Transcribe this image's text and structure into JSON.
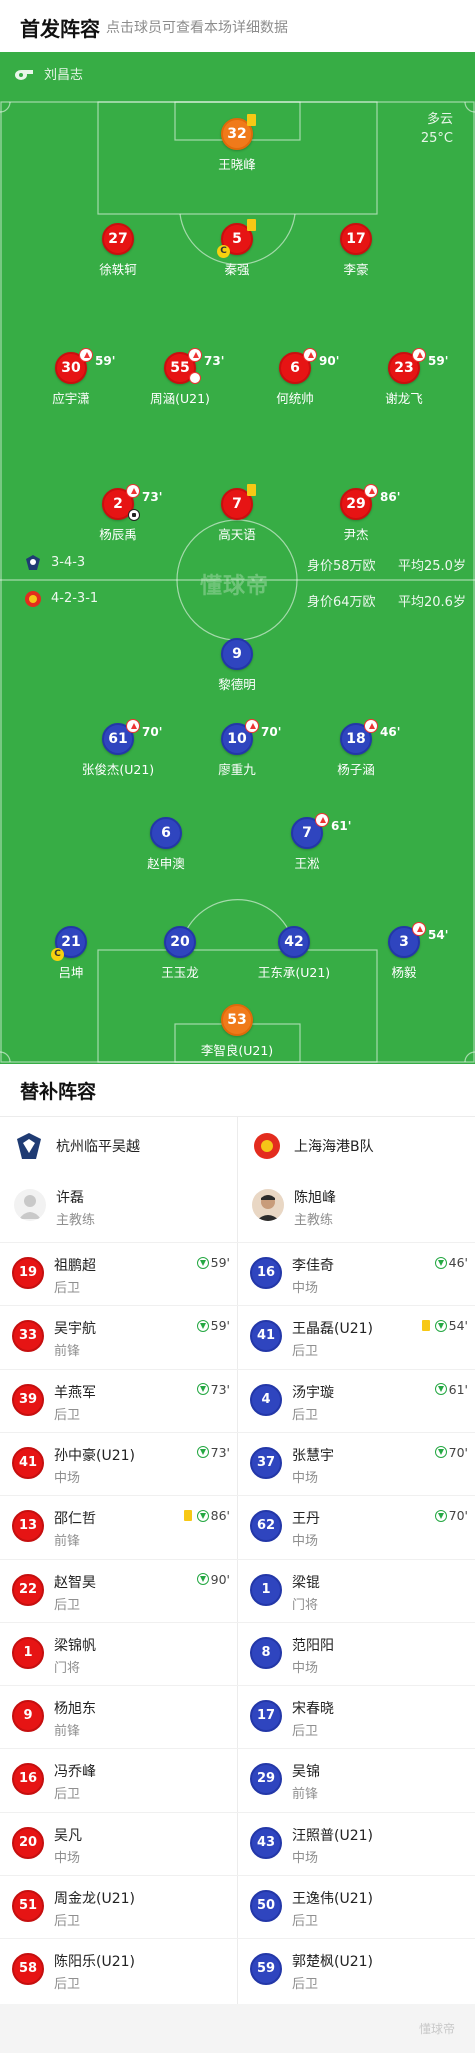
{
  "header": {
    "title": "首发阵容",
    "subtitle": "点击球员可查看本场详细数据"
  },
  "referee": {
    "icon": "whistle-icon",
    "name": "刘昌志"
  },
  "weather": {
    "condition": "多云",
    "temperature": "25°C"
  },
  "watermark": "懂球帝",
  "home": {
    "formation": "3-4-3",
    "value": "身价58万欧",
    "age": "平均25.0岁",
    "color": "#e61414",
    "players": [
      {
        "num": "32",
        "name": "王晓峰",
        "gk": true,
        "yellow": true
      },
      {
        "num": "27",
        "name": "徐轶轲"
      },
      {
        "num": "5",
        "name": "秦强",
        "yellow": true,
        "captain": true
      },
      {
        "num": "17",
        "name": "李豪"
      },
      {
        "num": "30",
        "name": "应宇潇",
        "sub": "59'"
      },
      {
        "num": "55",
        "name": "周涵(U21)",
        "sub": "73'",
        "own_goal": true
      },
      {
        "num": "6",
        "name": "何统帅",
        "sub": "90'"
      },
      {
        "num": "23",
        "name": "谢龙飞",
        "sub": "59'"
      },
      {
        "num": "2",
        "name": "杨辰禹",
        "sub": "73'",
        "goal": true
      },
      {
        "num": "7",
        "name": "高天语",
        "yellow": true
      },
      {
        "num": "29",
        "name": "尹杰",
        "sub": "86'"
      }
    ]
  },
  "away": {
    "formation": "4-2-3-1",
    "value": "身价64万欧",
    "age": "平均20.6岁",
    "color": "#2f45bf",
    "players": [
      {
        "num": "9",
        "name": "黎德明"
      },
      {
        "num": "61",
        "name": "张俊杰(U21)",
        "sub": "70'"
      },
      {
        "num": "10",
        "name": "廖重九",
        "sub": "70'"
      },
      {
        "num": "18",
        "name": "杨子涵",
        "sub": "46'"
      },
      {
        "num": "6",
        "name": "赵申澳"
      },
      {
        "num": "7",
        "name": "王淞",
        "sub": "61'"
      },
      {
        "num": "21",
        "name": "吕坤",
        "captain": true
      },
      {
        "num": "20",
        "name": "王玉龙"
      },
      {
        "num": "42",
        "name": "王东承(U21)"
      },
      {
        "num": "3",
        "name": "杨毅",
        "sub": "54'"
      },
      {
        "num": "53",
        "name": "李智良(U21)",
        "gk": true
      }
    ]
  },
  "subs": {
    "title": "替补阵容",
    "home": {
      "team": "杭州临平吴越",
      "coach": {
        "name": "许磊",
        "role": "主教练"
      },
      "players": [
        {
          "num": "19",
          "name": "祖鹏超",
          "pos": "后卫",
          "in": "59'"
        },
        {
          "num": "33",
          "name": "吴宇航",
          "pos": "前锋",
          "in": "59'"
        },
        {
          "num": "39",
          "name": "羊燕军",
          "pos": "后卫",
          "in": "73'"
        },
        {
          "num": "41",
          "name": "孙中豪(U21)",
          "pos": "中场",
          "in": "73'"
        },
        {
          "num": "13",
          "name": "邵仁哲",
          "pos": "前锋",
          "in": "86'",
          "yellow": true
        },
        {
          "num": "22",
          "name": "赵智昊",
          "pos": "后卫",
          "in": "90'"
        },
        {
          "num": "1",
          "name": "梁锦帆",
          "pos": "门将"
        },
        {
          "num": "9",
          "name": "杨旭东",
          "pos": "前锋"
        },
        {
          "num": "16",
          "name": "冯乔峰",
          "pos": "后卫"
        },
        {
          "num": "20",
          "name": "吴凡",
          "pos": "中场"
        },
        {
          "num": "51",
          "name": "周金龙(U21)",
          "pos": "后卫"
        },
        {
          "num": "58",
          "name": "陈阳乐(U21)",
          "pos": "后卫"
        }
      ]
    },
    "away": {
      "team": "上海海港B队",
      "coach": {
        "name": "陈旭峰",
        "role": "主教练"
      },
      "players": [
        {
          "num": "16",
          "name": "李佳奇",
          "pos": "中场",
          "in": "46'"
        },
        {
          "num": "41",
          "name": "王晶磊(U21)",
          "pos": "后卫",
          "in": "54'",
          "yellow": true
        },
        {
          "num": "4",
          "name": "汤宇璇",
          "pos": "后卫",
          "in": "61'"
        },
        {
          "num": "37",
          "name": "张慧宇",
          "pos": "中场",
          "in": "70'"
        },
        {
          "num": "62",
          "name": "王丹",
          "pos": "中场",
          "in": "70'"
        },
        {
          "num": "1",
          "name": "梁锟",
          "pos": "门将"
        },
        {
          "num": "8",
          "name": "范阳阳",
          "pos": "中场"
        },
        {
          "num": "17",
          "name": "宋春晓",
          "pos": "后卫"
        },
        {
          "num": "29",
          "name": "吴锦",
          "pos": "前锋"
        },
        {
          "num": "43",
          "name": "汪照普(U21)",
          "pos": "中场"
        },
        {
          "num": "50",
          "name": "王逸伟(U21)",
          "pos": "后卫"
        },
        {
          "num": "59",
          "name": "郭楚枫(U21)",
          "pos": "后卫"
        }
      ]
    }
  },
  "footer": {
    "watermark": "懂球帝"
  }
}
